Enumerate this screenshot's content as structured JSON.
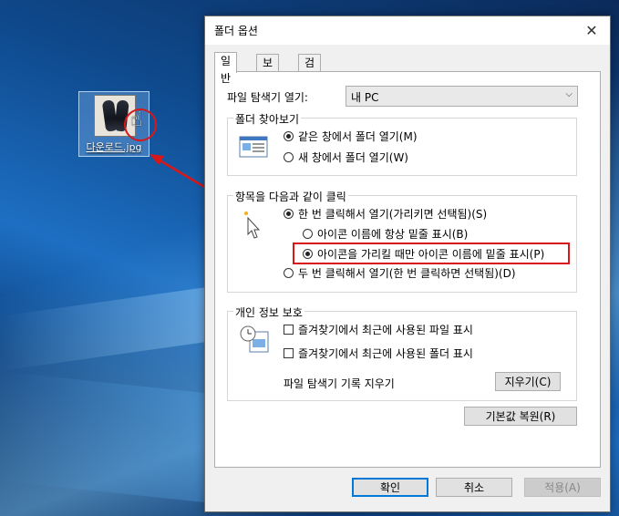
{
  "desktop": {
    "icon_label": "다운로드.jpg",
    "icon_name": "image-file-thumbnail",
    "annotation_color": "#d81818"
  },
  "dialog": {
    "title": "폴더 옵션",
    "close_icon": "close-icon",
    "tabs": [
      {
        "label": "일반",
        "active": true
      },
      {
        "label": "보기",
        "active": false
      },
      {
        "label": "검색",
        "active": false
      }
    ],
    "explorer_open": {
      "label": "파일 탐색기 열기:",
      "selected": "내 PC"
    },
    "browse_folders": {
      "title": "폴더 찾아보기",
      "options": [
        {
          "label": "같은 창에서 폴더 열기(M)",
          "selected": true
        },
        {
          "label": "새 창에서 폴더 열기(W)",
          "selected": false
        }
      ]
    },
    "click_items": {
      "title": "항목을 다음과 같이 클릭",
      "options": [
        {
          "label": "한 번 클릭해서 열기(가리키면 선택됨)(S)",
          "selected": true
        },
        {
          "label": "아이콘 이름에 항상 밑줄 표시(B)",
          "selected": false
        },
        {
          "label": "아이콘을 가리킬 때만 아이콘 이름에 밑줄 표시(P)",
          "selected": true
        },
        {
          "label": "두 번 클릭해서 열기(한 번 클릭하면 선택됨)(D)",
          "selected": false
        }
      ]
    },
    "privacy": {
      "title": "개인 정보 보호",
      "checks": [
        {
          "label": "즐겨찾기에서 최근에 사용된 파일 표시",
          "checked": false
        },
        {
          "label": "즐겨찾기에서 최근에 사용된 폴더 표시",
          "checked": false
        }
      ],
      "clear_label": "파일 탐색기 기록 지우기",
      "clear_button": "지우기(C)"
    },
    "restore_button": "기본값 복원(R)",
    "footer": {
      "ok": "확인",
      "cancel": "취소",
      "apply": "적용(A)"
    },
    "accent_color": "#0078d7"
  }
}
